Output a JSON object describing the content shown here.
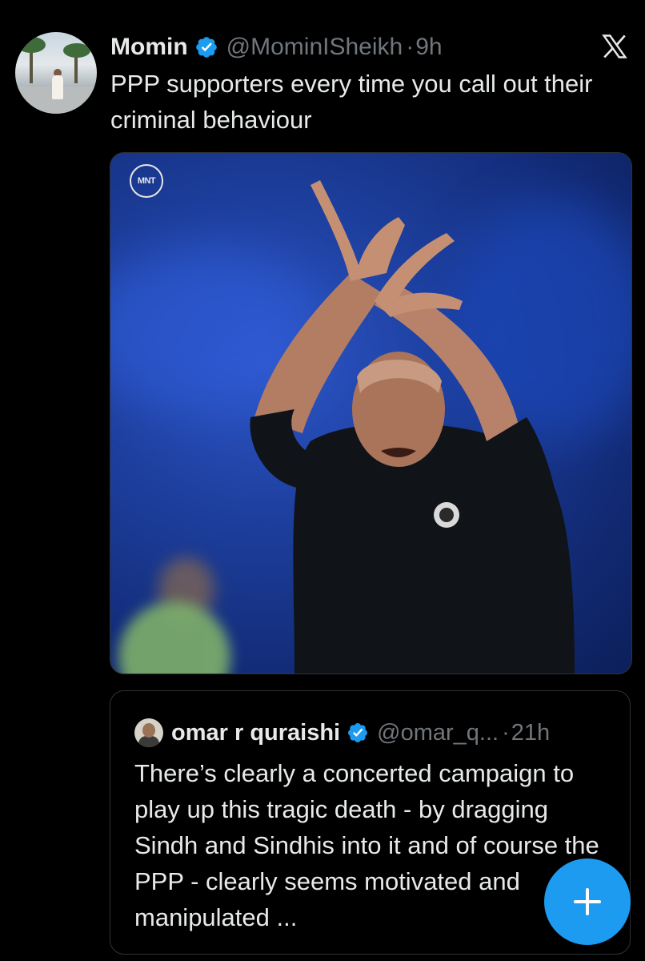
{
  "tweet": {
    "author_name": "Momin",
    "author_handle": "@MominISheikh",
    "separator": "·",
    "time": "9h",
    "text": "PPP supporters every time you call out their criminal behaviour",
    "media_watermark": "MNT"
  },
  "quoted_tweet": {
    "author_name": "omar r quraishi",
    "author_handle": "@omar_q...",
    "separator": "·",
    "time": "21h",
    "text": "There’s clearly a concerted campaign to play up this tragic death - by dragging Sindh and Sindhis into it and of course the PPP - clearly seems motivated and manipulated ..."
  },
  "icons": {
    "verified": "verified-badge-icon",
    "brand": "x-logo-icon",
    "compose": "plus-icon"
  },
  "colors": {
    "background": "#000000",
    "text_primary": "#e7e9ea",
    "text_secondary": "#71767b",
    "accent": "#1d9bf0",
    "border": "#2f3336"
  }
}
